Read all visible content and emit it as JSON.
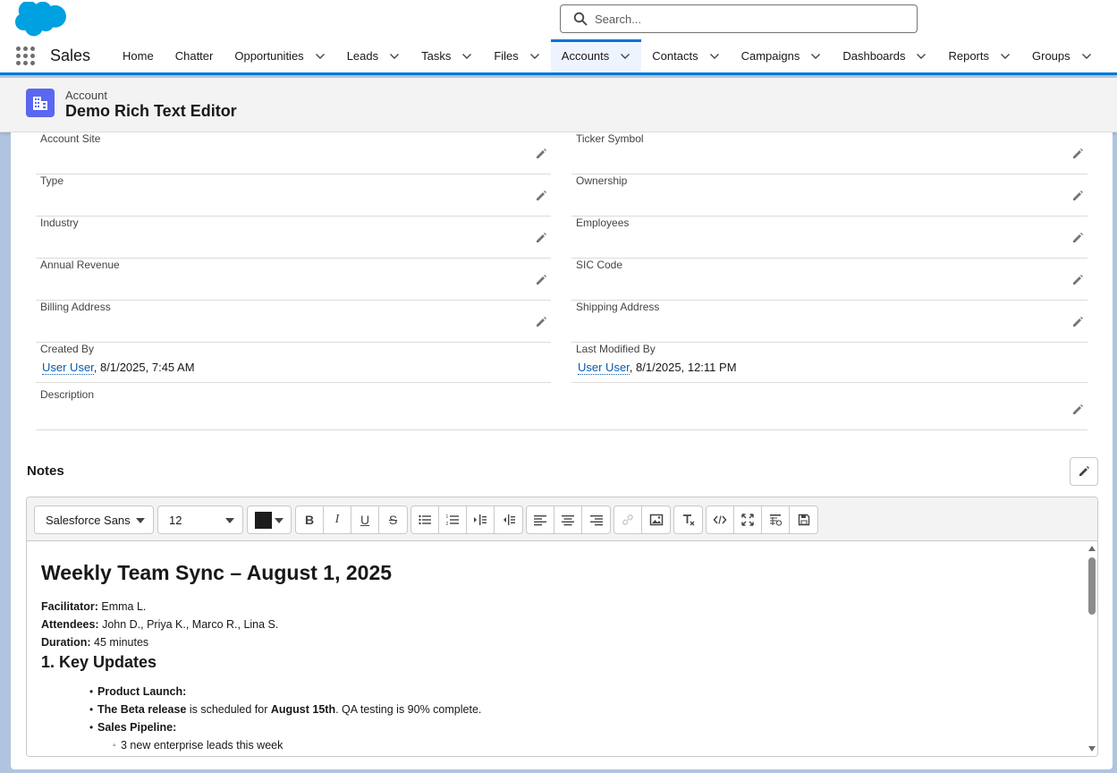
{
  "header": {
    "search_placeholder": "Search..."
  },
  "nav": {
    "app_name": "Sales",
    "items": [
      {
        "label": "Home",
        "dropdown": false
      },
      {
        "label": "Chatter",
        "dropdown": false
      },
      {
        "label": "Opportunities",
        "dropdown": true
      },
      {
        "label": "Leads",
        "dropdown": true
      },
      {
        "label": "Tasks",
        "dropdown": true
      },
      {
        "label": "Files",
        "dropdown": true
      },
      {
        "label": "Accounts",
        "dropdown": true,
        "active": true
      },
      {
        "label": "Contacts",
        "dropdown": true
      },
      {
        "label": "Campaigns",
        "dropdown": true
      },
      {
        "label": "Dashboards",
        "dropdown": true
      },
      {
        "label": "Reports",
        "dropdown": true
      },
      {
        "label": "Groups",
        "dropdown": true
      }
    ]
  },
  "record": {
    "type_label": "Account",
    "name": "Demo Rich Text Editor"
  },
  "fields": {
    "account_site": "Account Site",
    "ticker_symbol": "Ticker Symbol",
    "type": "Type",
    "ownership": "Ownership",
    "industry": "Industry",
    "employees": "Employees",
    "annual_revenue": "Annual Revenue",
    "sic_code": "SIC Code",
    "billing_address": "Billing Address",
    "shipping_address": "Shipping Address",
    "created_by": {
      "label": "Created By",
      "user": "User User",
      "date": ", 8/1/2025, 7:45 AM"
    },
    "last_modified_by": {
      "label": "Last Modified By",
      "user": "User User",
      "date": ", 8/1/2025, 12:11 PM"
    },
    "description": "Description"
  },
  "notes": {
    "title": "Notes",
    "toolbar": {
      "font_family": "Salesforce Sans",
      "font_size": "12",
      "text_color": "#1c1c1c"
    },
    "content": {
      "heading": "Weekly Team Sync – August 1, 2025",
      "facilitator_label": "Facilitator:",
      "facilitator_value": " Emma L.",
      "attendees_label": "Attendees:",
      "attendees_value": " John D., Priya K., Marco R., Lina S.",
      "duration_label": "Duration:",
      "duration_value": " 45 minutes",
      "section_1": "1. Key Updates",
      "bullet_1": "Product Launch:",
      "bullet_2_bold": "The Beta release",
      "bullet_2_mid": " is scheduled for ",
      "bullet_2_bold2": "August 15th",
      "bullet_2_end": ". QA testing is 90% complete.",
      "bullet_3": "Sales Pipeline:",
      "sub_bullet_1": "3 new enterprise leads this week"
    }
  },
  "colors": {
    "brand": "#0176d3",
    "account_icon": "#5a67f0",
    "link": "#0b5cab"
  }
}
